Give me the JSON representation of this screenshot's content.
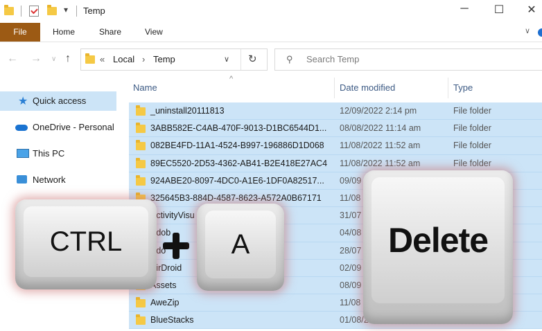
{
  "window": {
    "title": "Temp",
    "controls": [
      "─",
      "☐",
      "✕"
    ]
  },
  "ribbon": {
    "file_tab": "File",
    "tabs": [
      "Home",
      "Share",
      "View"
    ]
  },
  "address": {
    "prefix": "«",
    "crumbs": [
      "Local",
      "›",
      "Temp"
    ],
    "search_placeholder": "Search Temp"
  },
  "navpane": {
    "items": [
      {
        "label": "Quick access",
        "icon": "star-icon"
      },
      {
        "label": "OneDrive - Personal",
        "icon": "cloud-icon"
      },
      {
        "label": "This PC",
        "icon": "pc-icon"
      },
      {
        "label": "Network",
        "icon": "network-icon"
      }
    ]
  },
  "list": {
    "columns": [
      "Name",
      "Date modified",
      "Type"
    ],
    "rows": [
      {
        "name": "_uninstall20111813",
        "date": "12/09/2022 2:14 pm",
        "type": "File folder"
      },
      {
        "name": "3ABB582E-C4AB-470F-9013-D1BC6544D1...",
        "date": "08/08/2022 11:14 am",
        "type": "File folder"
      },
      {
        "name": "082BE4FD-11A1-4524-B997-196886D1D068",
        "date": "11/08/2022 11:52 am",
        "type": "File folder"
      },
      {
        "name": "89EC5520-2D53-4362-AB41-B2E418E27AC4",
        "date": "11/08/2022 11:52 am",
        "type": "File folder"
      },
      {
        "name": "924ABE20-8097-4DC0-A1E6-1DF0A82517...",
        "date": "09/09",
        "type": ""
      },
      {
        "name": "325645B3-884D-4587-8623-A572A0B67171",
        "date": "11/08",
        "type": ""
      },
      {
        "name": "ActivityVisu",
        "date": "31/07",
        "type": ""
      },
      {
        "name": "Adob",
        "date": "04/08",
        "type": ""
      },
      {
        "name": "Ado",
        "date": "28/07",
        "type": ""
      },
      {
        "name": "AirDroid",
        "date": "02/09",
        "type": ""
      },
      {
        "name": "Assets",
        "date": "08/09",
        "type": ""
      },
      {
        "name": "AweZip",
        "date": "11/08",
        "type": ""
      },
      {
        "name": "BlueStacks",
        "date": "01/08/2022",
        "type": ""
      }
    ]
  },
  "overlay": {
    "key_ctrl": "CTRL",
    "key_a": "A",
    "key_delete": "Delete"
  },
  "colors": {
    "file_tab": "#9c5a14",
    "selection": "#cce4f7",
    "folder": "#f5c945"
  }
}
